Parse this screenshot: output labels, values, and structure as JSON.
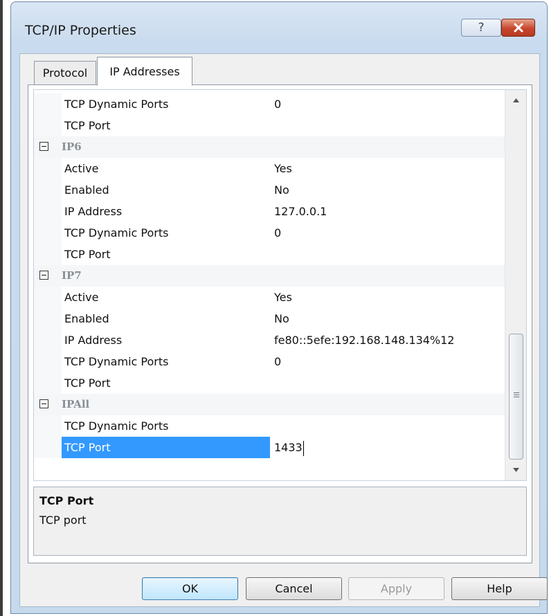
{
  "window": {
    "title": "TCP/IP Properties",
    "help_label": "?"
  },
  "tabs": [
    {
      "label": "Protocol",
      "selected": false
    },
    {
      "label": "IP Addresses",
      "selected": true
    }
  ],
  "grid": {
    "rows": [
      {
        "type": "prop",
        "name": "TCP Dynamic Ports",
        "value": "0"
      },
      {
        "type": "prop",
        "name": "TCP Port",
        "value": ""
      },
      {
        "type": "category",
        "name": "IP6"
      },
      {
        "type": "prop",
        "name": "Active",
        "value": "Yes"
      },
      {
        "type": "prop",
        "name": "Enabled",
        "value": "No"
      },
      {
        "type": "prop",
        "name": "IP Address",
        "value": "127.0.0.1"
      },
      {
        "type": "prop",
        "name": "TCP Dynamic Ports",
        "value": "0"
      },
      {
        "type": "prop",
        "name": "TCP Port",
        "value": ""
      },
      {
        "type": "category",
        "name": "IP7"
      },
      {
        "type": "prop",
        "name": "Active",
        "value": "Yes"
      },
      {
        "type": "prop",
        "name": "Enabled",
        "value": "No"
      },
      {
        "type": "prop",
        "name": "IP Address",
        "value": "fe80::5efe:192.168.148.134%12"
      },
      {
        "type": "prop",
        "name": "TCP Dynamic Ports",
        "value": "0"
      },
      {
        "type": "prop",
        "name": "TCP Port",
        "value": ""
      },
      {
        "type": "category",
        "name": "IPAll"
      },
      {
        "type": "prop",
        "name": "TCP Dynamic Ports",
        "value": ""
      },
      {
        "type": "prop",
        "name": "TCP Port",
        "value": "1433",
        "selected": true,
        "editing": true
      }
    ]
  },
  "description": {
    "title": "TCP Port",
    "text": "TCP port"
  },
  "buttons": {
    "ok": "OK",
    "cancel": "Cancel",
    "apply": "Apply",
    "help": "Help"
  },
  "colors": {
    "selection": "#3399ff",
    "category_text": "#8a8f96",
    "close_button": "#c7462d"
  }
}
